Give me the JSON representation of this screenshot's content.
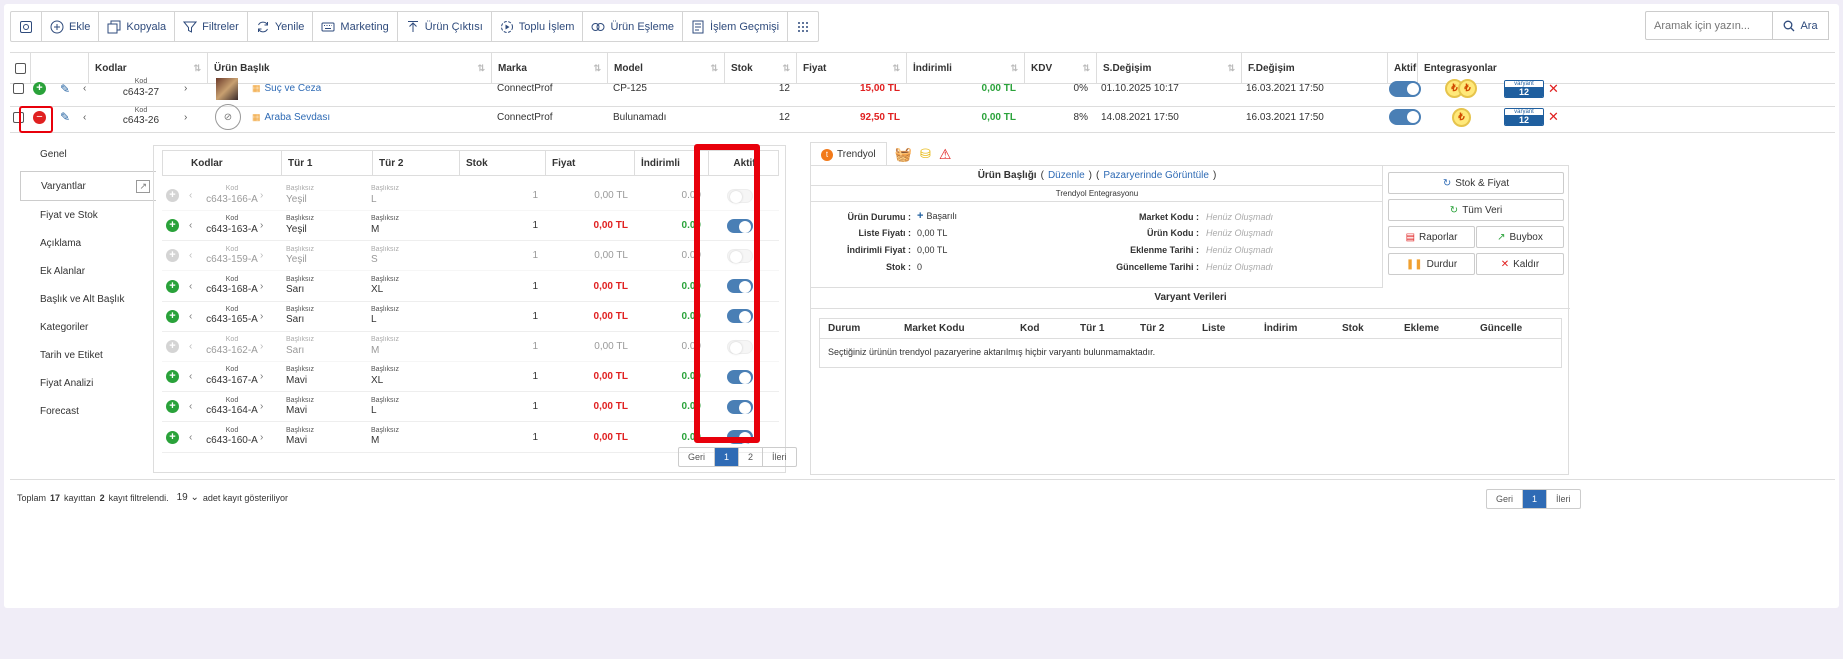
{
  "toolbar": {
    "buttons": [
      {
        "label": "",
        "icon": "settings-icon"
      },
      {
        "label": "Ekle",
        "icon": "plus-circle-icon"
      },
      {
        "label": "Kopyala",
        "icon": "copy-icon"
      },
      {
        "label": "Filtreler",
        "icon": "filter-icon"
      },
      {
        "label": "Yenile",
        "icon": "refresh-icon"
      },
      {
        "label": "Marketing",
        "icon": "keyboard-icon"
      },
      {
        "label": "Ürün Çıktısı",
        "icon": "upload-icon"
      },
      {
        "label": "Toplu İşlem",
        "icon": "batch-icon"
      },
      {
        "label": "Ürün Eşleme",
        "icon": "link-icon"
      },
      {
        "label": "İşlem Geçmişi",
        "icon": "history-icon"
      },
      {
        "label": "",
        "icon": "grid-menu-icon"
      }
    ]
  },
  "search": {
    "placeholder": "Aramak için yazın...",
    "button_label": "Ara"
  },
  "grid": {
    "headers": {
      "kodlar": "Kodlar",
      "urun_baslik": "Ürün Başlık",
      "marka": "Marka",
      "model": "Model",
      "stok": "Stok",
      "fiyat": "Fiyat",
      "indirimli": "İndirimli",
      "kdv": "KDV",
      "s_degisim": "S.Değişim",
      "f_degisim": "F.Değişim",
      "aktif": "Aktif",
      "entegrasyonlar": "Entegrasyonlar"
    },
    "rows": [
      {
        "kod_label": "Kod",
        "kod": "c643-27",
        "title": "Suç ve Ceza",
        "marka": "ConnectProf",
        "model": "CP-125",
        "stok": "12",
        "fiyat": "15,00 TL",
        "indirimli": "0,00 TL",
        "kdv": "0%",
        "s_degisim": "01.10.2025 10:17",
        "f_degisim": "16.03.2021 17:50",
        "badge_label": "varyant",
        "badge_count": "12"
      },
      {
        "kod_label": "Kod",
        "kod": "c643-26",
        "title": "Araba Sevdası",
        "marka": "ConnectProf",
        "model": "Bulunamadı",
        "stok": "12",
        "fiyat": "92,50 TL",
        "indirimli": "0,00 TL",
        "kdv": "8%",
        "s_degisim": "14.08.2021 17:50",
        "f_degisim": "16.03.2021 17:50",
        "badge_label": "varyant",
        "badge_count": "12"
      }
    ]
  },
  "sidenav": {
    "items": [
      "Genel",
      "Varyantlar",
      "Fiyat ve Stok",
      "Açıklama",
      "Ek Alanlar",
      "Başlık ve Alt Başlık",
      "Kategoriler",
      "Tarih ve Etiket",
      "Fiyat Analizi",
      "Forecast"
    ],
    "active_index": 1
  },
  "variants": {
    "headers": {
      "kodlar": "Kodlar",
      "tur1": "Tür 1",
      "tur2": "Tür 2",
      "stok": "Stok",
      "fiyat": "Fiyat",
      "indirimli": "İndirimli",
      "aktif": "Aktif"
    },
    "kod_label": "Kod",
    "sub_label": "Başlıksız",
    "rows": [
      {
        "kod": "c643-166-A",
        "tur1": "Yeşil",
        "tur2": "L",
        "stok": "1",
        "fiyat": "0,00 TL",
        "indirimli": "0.00",
        "active": false
      },
      {
        "kod": "c643-163-A",
        "tur1": "Yeşil",
        "tur2": "M",
        "stok": "1",
        "fiyat": "0,00 TL",
        "indirimli": "0.00",
        "active": true
      },
      {
        "kod": "c643-159-A",
        "tur1": "Yeşil",
        "tur2": "S",
        "stok": "1",
        "fiyat": "0,00 TL",
        "indirimli": "0.00",
        "active": false
      },
      {
        "kod": "c643-168-A",
        "tur1": "Sarı",
        "tur2": "XL",
        "stok": "1",
        "fiyat": "0,00 TL",
        "indirimli": "0.00",
        "active": true
      },
      {
        "kod": "c643-165-A",
        "tur1": "Sarı",
        "tur2": "L",
        "stok": "1",
        "fiyat": "0,00 TL",
        "indirimli": "0.00",
        "active": true
      },
      {
        "kod": "c643-162-A",
        "tur1": "Sarı",
        "tur2": "M",
        "stok": "1",
        "fiyat": "0,00 TL",
        "indirimli": "0.00",
        "active": false
      },
      {
        "kod": "c643-167-A",
        "tur1": "Mavi",
        "tur2": "XL",
        "stok": "1",
        "fiyat": "0,00 TL",
        "indirimli": "0.00",
        "active": true
      },
      {
        "kod": "c643-164-A",
        "tur1": "Mavi",
        "tur2": "L",
        "stok": "1",
        "fiyat": "0,00 TL",
        "indirimli": "0.00",
        "active": true
      },
      {
        "kod": "c643-160-A",
        "tur1": "Mavi",
        "tur2": "M",
        "stok": "1",
        "fiyat": "0,00 TL",
        "indirimli": "0.00",
        "active": true
      }
    ],
    "pager": {
      "prev": "Geri",
      "p1": "1",
      "p2": "2",
      "next": "İleri"
    }
  },
  "trendyol": {
    "tab_label": "Trendyol",
    "title": "Ürün Başlığı",
    "edit_link": "Düzenle",
    "market_link": "Pazaryerinde Görüntüle",
    "subtitle": "Trendyol Entegrasyonu",
    "fields": {
      "durum_label": "Ürün Durumu :",
      "durum_value": "Başarılı",
      "liste_label": "Liste Fiyatı :",
      "liste_value": "0,00 TL",
      "indirimli_label": "İndirimli Fiyat :",
      "indirimli_value": "0,00 TL",
      "stok_label": "Stok :",
      "stok_value": "0",
      "market_kodu_label": "Market Kodu :",
      "urun_kodu_label": "Ürün Kodu :",
      "eklenme_label": "Eklenme Tarihi :",
      "guncelleme_label": "Güncelleme Tarihi :",
      "placeholder": "Henüz Oluşmadı"
    },
    "actions": {
      "stok_fiyat": "Stok & Fiyat",
      "tum_veri": "Tüm Veri",
      "raporlar": "Raporlar",
      "buybox": "Buybox",
      "durdur": "Durdur",
      "kaldir": "Kaldır"
    },
    "variant_data_title": "Varyant Verileri",
    "vd_headers": [
      "Durum",
      "Market Kodu",
      "Kod",
      "Tür 1",
      "Tür 2",
      "Liste",
      "İndirim",
      "Stok",
      "Ekleme",
      "Güncelle"
    ],
    "empty_message": "Seçtiğiniz ürünün trendyol pazaryerine aktarılmış hiçbir varyantı bulunmamaktadır."
  },
  "footer": {
    "text1": "Toplam",
    "total": "17",
    "text2": "kayıttan",
    "filtered": "2",
    "text3": "kayıt filtrelendi.",
    "per_page": "19",
    "text4": "adet kayıt gösteriliyor"
  },
  "main_pager": {
    "prev": "Geri",
    "p1": "1",
    "next": "İleri"
  },
  "colors": {
    "accent": "#2f6bb5",
    "highlight": "#e8000b",
    "price_red": "#e02020",
    "green": "#2aa23a"
  }
}
